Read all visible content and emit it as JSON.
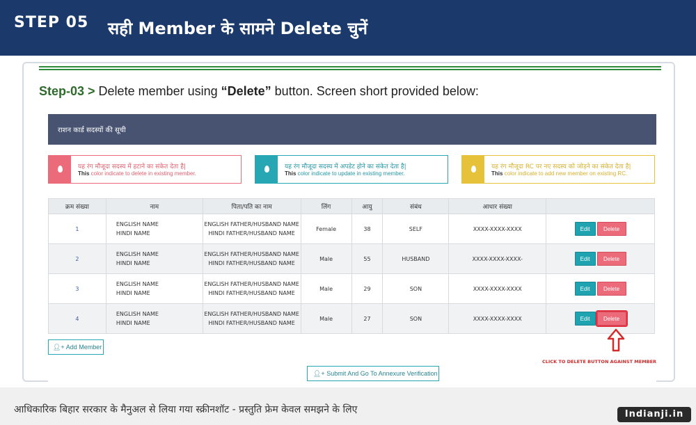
{
  "header": {
    "step": "STEP 05",
    "title": "सही Member के सामने Delete चुनें"
  },
  "instruction": {
    "step": "Step-03",
    "gt": " > ",
    "pre": "Delete member using ",
    "bold": "“Delete”",
    "post": " button. Screen short provided below:"
  },
  "panel": {
    "title": "राशन कार्ड सदस्यों की सूची"
  },
  "legend": [
    {
      "hi": "यह रंग मौजूदा सदस्य में हटाने का संकेत देता है|",
      "en_bold": "This",
      "en": " color indicate to delete in existing member.",
      "color": "#ec6b7a"
    },
    {
      "hi": "यह रंग मौजूदा सदस्य में अपडेट होने का संकेत देता है|",
      "en_bold": "This",
      "en": " color indicate to update in existing member.",
      "color": "#27a6b4"
    },
    {
      "hi": "यह रंग मौजूदा RC पर नए सदस्य को जोड़ने का संकेत देता है|",
      "en_bold": "This",
      "en": " color indicate to add new member on existing RC.",
      "color": "#e6c13a"
    }
  ],
  "table": {
    "headers": [
      "क्रम संख्या",
      "नाम",
      "पिता/पति का नाम",
      "लिंग",
      "आयु",
      "संबंध",
      "आधार संख्या",
      ""
    ],
    "rows": [
      {
        "sn": "1",
        "name_en": "ENGLISH NAME",
        "name_hi": "HINDI NAME",
        "father_en": "ENGLISH FATHER/HUSBAND NAME",
        "father_hi": "HINDI FATHER/HUSBAND NAME",
        "gender": "Female",
        "age": "38",
        "relation": "SELF",
        "aadhaar": "XXXX-XXXX-XXXX"
      },
      {
        "sn": "2",
        "name_en": "ENGLISH NAME",
        "name_hi": "HINDI NAME",
        "father_en": "ENGLISH FATHER/HUSBAND NAME",
        "father_hi": "HINDI FATHER/HUSBAND NAME",
        "gender": "Male",
        "age": "55",
        "relation": "HUSBAND",
        "aadhaar": "XXXX-XXXX-XXXX-"
      },
      {
        "sn": "3",
        "name_en": "ENGLISH NAME",
        "name_hi": "HINDI NAME",
        "father_en": "ENGLISH FATHER/HUSBAND NAME",
        "father_hi": "HINDI FATHER/HUSBAND NAME",
        "gender": "Male",
        "age": "29",
        "relation": "SON",
        "aadhaar": "XXXX-XXXX-XXXX"
      },
      {
        "sn": "4",
        "name_en": "ENGLISH NAME",
        "name_hi": "HINDI NAME",
        "father_en": "ENGLISH FATHER/HUSBAND NAME",
        "father_hi": "HINDI FATHER/HUSBAND NAME",
        "gender": "Male",
        "age": "27",
        "relation": "SON",
        "aadhaar": "XXXX-XXXX-XXXX"
      }
    ],
    "edit_label": "Edit",
    "delete_label": "Delete"
  },
  "buttons": {
    "add_member": "Add Member",
    "submit": "Submit And Go To Annexure Verification"
  },
  "note": "CLICK TO DELETE BUTTON AGAINST MEMBER",
  "footer": {
    "text": "आधिकारिक बिहार सरकार के मैनुअल से लिया गया स्क्रीनशॉट - प्रस्तुति फ्रेम केवल समझने के लिए",
    "brand": "Indianji.in"
  }
}
